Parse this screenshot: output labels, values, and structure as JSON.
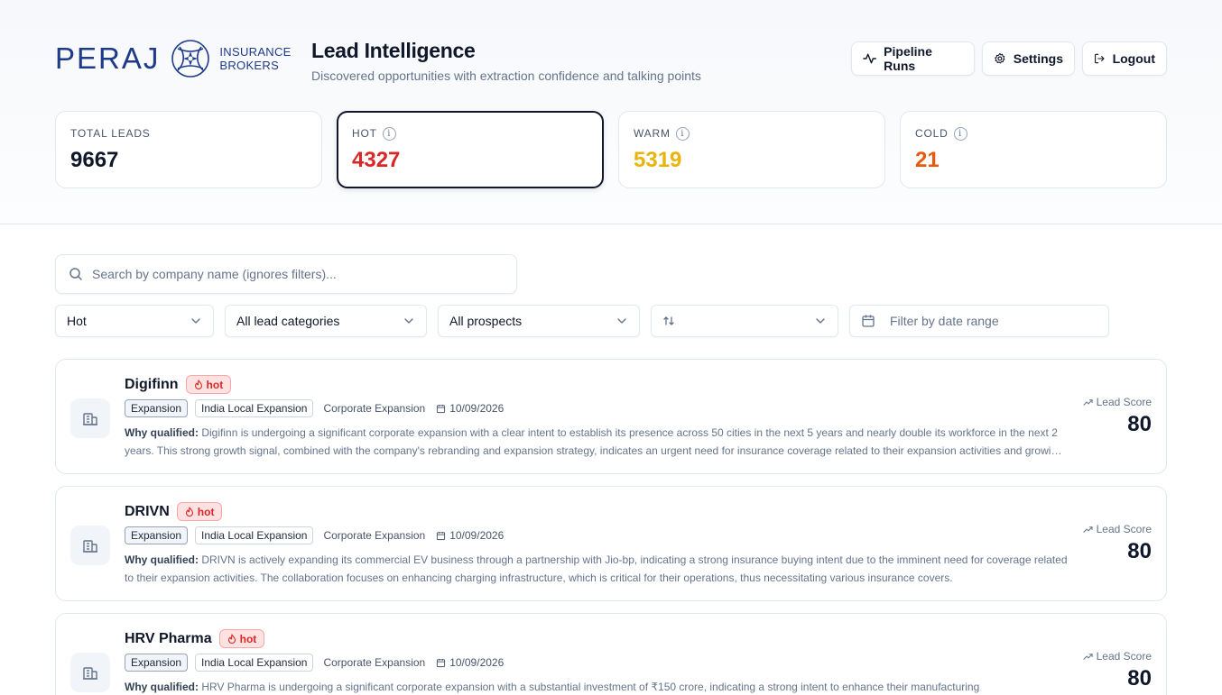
{
  "brand": {
    "name": "PERAJ",
    "sub_line1": "INSURANCE",
    "sub_line2": "BROKERS"
  },
  "header": {
    "title": "Lead Intelligence",
    "subtitle": "Discovered opportunities with extraction confidence and talking points",
    "buttons": {
      "pipeline": "Pipeline Runs",
      "settings": "Settings",
      "logout": "Logout"
    }
  },
  "stats": {
    "total": {
      "label": "TOTAL LEADS",
      "value": "9667"
    },
    "hot": {
      "label": "HOT",
      "value": "4327",
      "color": "#dc2626",
      "selected": true
    },
    "warm": {
      "label": "WARM",
      "value": "5319",
      "color": "#eab308"
    },
    "cold": {
      "label": "COLD",
      "value": "21",
      "color": "#ea580c"
    }
  },
  "search": {
    "placeholder": "Search by company name (ignores filters)...",
    "value": ""
  },
  "filters": {
    "status": "Hot",
    "categories": "All lead categories",
    "prospects": "All prospects",
    "sort": "",
    "date_placeholder": "Filter by date range"
  },
  "leads": [
    {
      "name": "Digifinn",
      "badge": "hot",
      "tags": [
        "Expansion",
        "India Local Expansion"
      ],
      "category": "Corporate Expansion",
      "date": "10/09/2026",
      "why_label": "Why qualified:",
      "why": "Digifinn is undergoing a significant corporate expansion with a clear intent to establish its presence across 50 cities in the next 5 years and nearly double its workforce in the next 2 years. This strong growth signal, combined with the company's rebranding and expansion strategy, indicates an urgent need for insurance coverage related to their expansion activities and growing workforce.",
      "score_label": "Lead Score",
      "score": "80"
    },
    {
      "name": "DRIVN",
      "badge": "hot",
      "tags": [
        "Expansion",
        "India Local Expansion"
      ],
      "category": "Corporate Expansion",
      "date": "10/09/2026",
      "why_label": "Why qualified:",
      "why": "DRIVN is actively expanding its commercial EV business through a partnership with Jio-bp, indicating a strong insurance buying intent due to the imminent need for coverage related to their expansion activities. The collaboration focuses on enhancing charging infrastructure, which is critical for their operations, thus necessitating various insurance covers.",
      "score_label": "Lead Score",
      "score": "80"
    },
    {
      "name": "HRV Pharma",
      "badge": "hot",
      "tags": [
        "Expansion",
        "India Local Expansion"
      ],
      "category": "Corporate Expansion",
      "date": "10/09/2026",
      "why_label": "Why qualified:",
      "why": "HRV Pharma is undergoing a significant corporate expansion with a substantial investment of ₹150 crore, indicating a strong intent to enhance their manufacturing",
      "score_label": "Lead Score",
      "score": "80"
    }
  ]
}
